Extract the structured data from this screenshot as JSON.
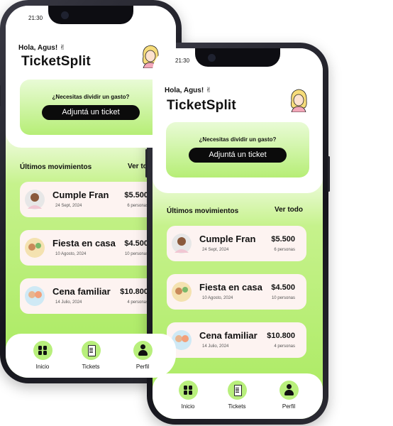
{
  "status_time": "21:30",
  "greeting": "Hola, Agus! ✌",
  "app_title": "TicketSplit",
  "cta": {
    "question": "¿Necesitas dividir un gasto?",
    "button": "Adjuntá un ticket"
  },
  "movements": {
    "title": "Últimos movimientos",
    "see_all": "Ver todo",
    "items": [
      {
        "name": "Cumple Fran",
        "date": "24 Sept, 2024",
        "amount": "$5.500",
        "people": "6 personas"
      },
      {
        "name": "Fiesta en casa",
        "date": "10 Agosto, 2024",
        "amount": "$4.500",
        "people": "10 personas"
      },
      {
        "name": "Cena familiar",
        "date": "14 Julio, 2024",
        "amount": "$10.800",
        "people": "4 personas"
      }
    ]
  },
  "tabs": [
    {
      "label": "Inicio",
      "icon": "grid-icon"
    },
    {
      "label": "Tickets",
      "icon": "document-icon"
    },
    {
      "label": "Perfil",
      "icon": "user-icon"
    }
  ],
  "back_phone": {
    "status_time": "21:30",
    "greeting": "Hola, Agus! ✌",
    "app_title": "TicketSplit",
    "cta": {
      "question": "¿Necesitas dividir un gasto?",
      "button": "Adjuntá un ticket"
    },
    "movements": {
      "title": "Últimos movimientos",
      "see_all": "Ver todo",
      "items": [
        {
          "name": "Cumple Fran",
          "date": "24 Sept, 2024",
          "amount": "$5.500",
          "people": "6 personas"
        },
        {
          "name": "Fiesta en casa",
          "date": "10 Agosto, 2024",
          "amount": "$4.500",
          "people": "10 personas"
        },
        {
          "name": "Cena familiar",
          "date": "14 Julio, 2024",
          "amount": "$10.800",
          "people": "4 personas"
        }
      ]
    },
    "tabs": [
      {
        "label": "Inicio",
        "icon": "grid-icon"
      },
      {
        "label": "Tickets",
        "icon": "document-icon"
      },
      {
        "label": "Perfil",
        "icon": "user-icon"
      }
    ]
  },
  "colors": {
    "accent": "#b8ef7c",
    "green_bottom": "#a9ea5f",
    "card_bg": "#fdf3f1",
    "button": "#0b0b0b"
  }
}
